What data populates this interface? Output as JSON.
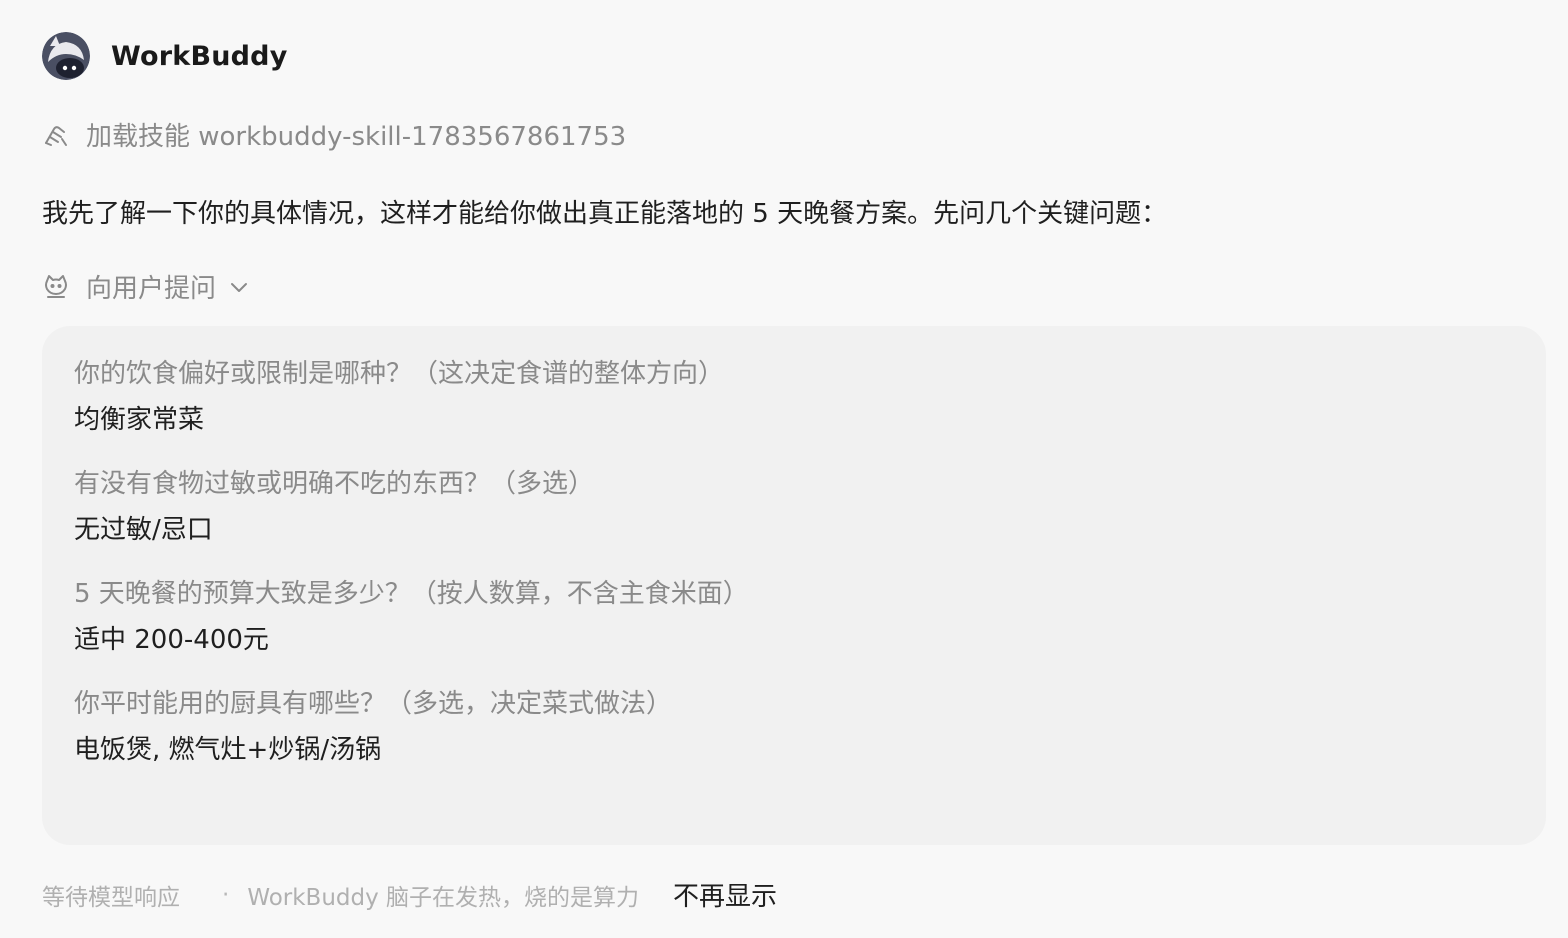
{
  "header": {
    "app_name": "WorkBuddy",
    "avatar_icon": "cat-mascot-avatar"
  },
  "skill": {
    "icon": "skill-load-icon",
    "text": "加载技能 workbuddy-skill-1783567861753"
  },
  "intro": "我先了解一下你的具体情况，这样才能给你做出真正能落地的 5 天晚餐方案。先问几个关键问题：",
  "ask_user": {
    "icon": "cat-face-icon",
    "label": "向用户提问",
    "chevron_icon": "chevron-down-icon"
  },
  "questions": [
    {
      "q": "你的饮食偏好或限制是哪种？（这决定食谱的整体方向）",
      "a": "均衡家常菜"
    },
    {
      "q": "有没有食物过敏或明确不吃的东西？（多选）",
      "a": "无过敏/忌口"
    },
    {
      "q": "5 天晚餐的预算大致是多少？（按人数算，不含主食米面）",
      "a": "适中 200-400元"
    },
    {
      "q": "你平时能用的厨具有哪些？（多选，决定菜式做法）",
      "a": "电饭煲, 燃气灶+炒锅/汤锅"
    }
  ],
  "footer": {
    "waiting": "等待模型响应",
    "dot": "·",
    "status": "WorkBuddy 脑子在发热，烧的是算力",
    "dismiss": "不再显示"
  },
  "colors": {
    "background": "#f8f8f8",
    "card": "#f1f1f1",
    "muted_text": "#8a8a8a",
    "main_text": "#1f1f1f"
  }
}
